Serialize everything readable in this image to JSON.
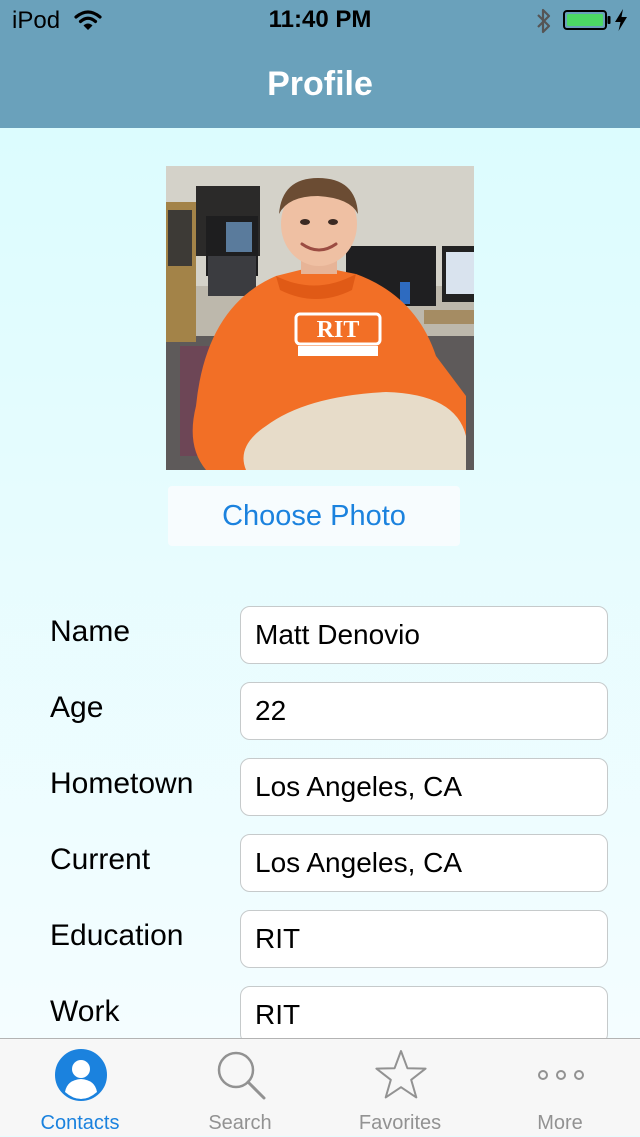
{
  "status_bar": {
    "carrier": "iPod",
    "time": "11:40 PM"
  },
  "nav": {
    "title": "Profile"
  },
  "profile": {
    "choose_photo_label": "Choose Photo"
  },
  "form": {
    "fields": [
      {
        "label": "Name",
        "value": "Matt Denovio"
      },
      {
        "label": "Age",
        "value": "22"
      },
      {
        "label": "Hometown",
        "value": "Los Angeles, CA"
      },
      {
        "label": "Current",
        "value": "Los Angeles, CA"
      },
      {
        "label": "Education",
        "value": "RIT"
      },
      {
        "label": "Work",
        "value": "RIT"
      }
    ]
  },
  "tabs": [
    {
      "label": "Contacts",
      "icon": "person-icon",
      "active": true
    },
    {
      "label": "Search",
      "icon": "search-icon",
      "active": false
    },
    {
      "label": "Favorites",
      "icon": "star-icon",
      "active": false
    },
    {
      "label": "More",
      "icon": "more-icon",
      "active": false
    }
  ],
  "colors": {
    "nav_bar": "#6aa1bb",
    "background": "#e6fdfe",
    "accent": "#1b82de",
    "battery": "#4cd964"
  }
}
